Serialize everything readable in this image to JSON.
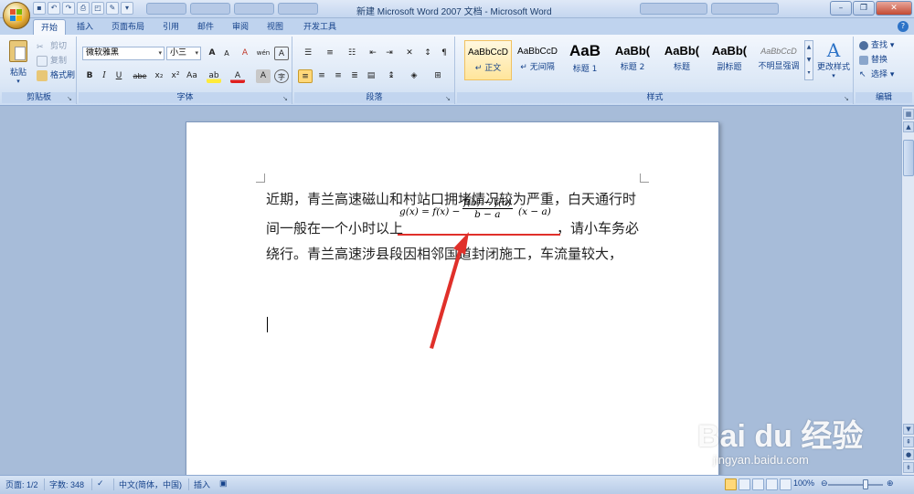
{
  "window": {
    "title": "新建 Microsoft Word 2007 文档 - Microsoft Word",
    "qat_icons": [
      "save-icon",
      "undo-icon",
      "redo-icon",
      "print-icon",
      "print-preview-icon",
      "format-painter-icon"
    ],
    "controls": [
      "minimize",
      "restore",
      "close"
    ]
  },
  "tabs": [
    {
      "label": "开始",
      "active": true
    },
    {
      "label": "插入"
    },
    {
      "label": "页面布局"
    },
    {
      "label": "引用"
    },
    {
      "label": "邮件"
    },
    {
      "label": "审阅"
    },
    {
      "label": "视图"
    },
    {
      "label": "开发工具"
    }
  ],
  "ribbon": {
    "clipboard": {
      "label": "剪贴板",
      "paste": "粘贴",
      "cut": "剪切",
      "copy": "复制",
      "format_painter": "格式刷"
    },
    "font": {
      "label": "字体",
      "font_name": "微软雅黑",
      "font_size": "小三",
      "bold": "B",
      "italic": "I",
      "underline": "U",
      "strike": "abe",
      "subscript": "x₂",
      "superscript": "x²",
      "change_case": "Aa",
      "grow": "A",
      "shrink": "A",
      "clear": "A",
      "phonetic": "wén",
      "border": "A",
      "highlight": "ab",
      "font_color": "A",
      "shading": "A",
      "enclose": "字"
    },
    "paragraph": {
      "label": "段落"
    },
    "styles": {
      "label": "样式",
      "items": [
        {
          "sample": "AaBbCcD",
          "name": "↵ 正文",
          "selected": true
        },
        {
          "sample": "AaBbCcD",
          "name": "↵ 无间隔"
        },
        {
          "sample": "AaB",
          "name": "标题 1"
        },
        {
          "sample": "AaBb(",
          "name": "标题 2"
        },
        {
          "sample": "AaBb(",
          "name": "标题"
        },
        {
          "sample": "AaBb(",
          "name": "副标题"
        },
        {
          "sample": "AaBbCcD",
          "name": "不明显强调"
        }
      ],
      "change_styles": "更改样式"
    },
    "editing": {
      "label": "编辑",
      "find": "查找",
      "replace": "替换",
      "select": "选择"
    }
  },
  "document": {
    "line1": "近期，青兰高速磁山和村站口拥堵情况较为严重，白天通行时",
    "line2_before": "间一般在一个小时以上",
    "formula": {
      "lhs": "g(x) = f(x) −",
      "num": "f(b) − f(a)",
      "den": "b − a",
      "rhs": "(x − a)"
    },
    "line2_after": "，请小车务必",
    "line3": "绕行。青兰高速涉县段因相邻国道封闭施工，车流量较大，"
  },
  "statusbar": {
    "page": "页面: 1/2",
    "words": "字数: 348",
    "language": "中文(简体，中国)",
    "mode": "插入",
    "zoom": "100%"
  },
  "watermark": {
    "brand": "Bai du 经验",
    "url": "jingyan.baidu.com"
  },
  "colors": {
    "accent": "#15428b",
    "annotation": "#e0302a"
  }
}
